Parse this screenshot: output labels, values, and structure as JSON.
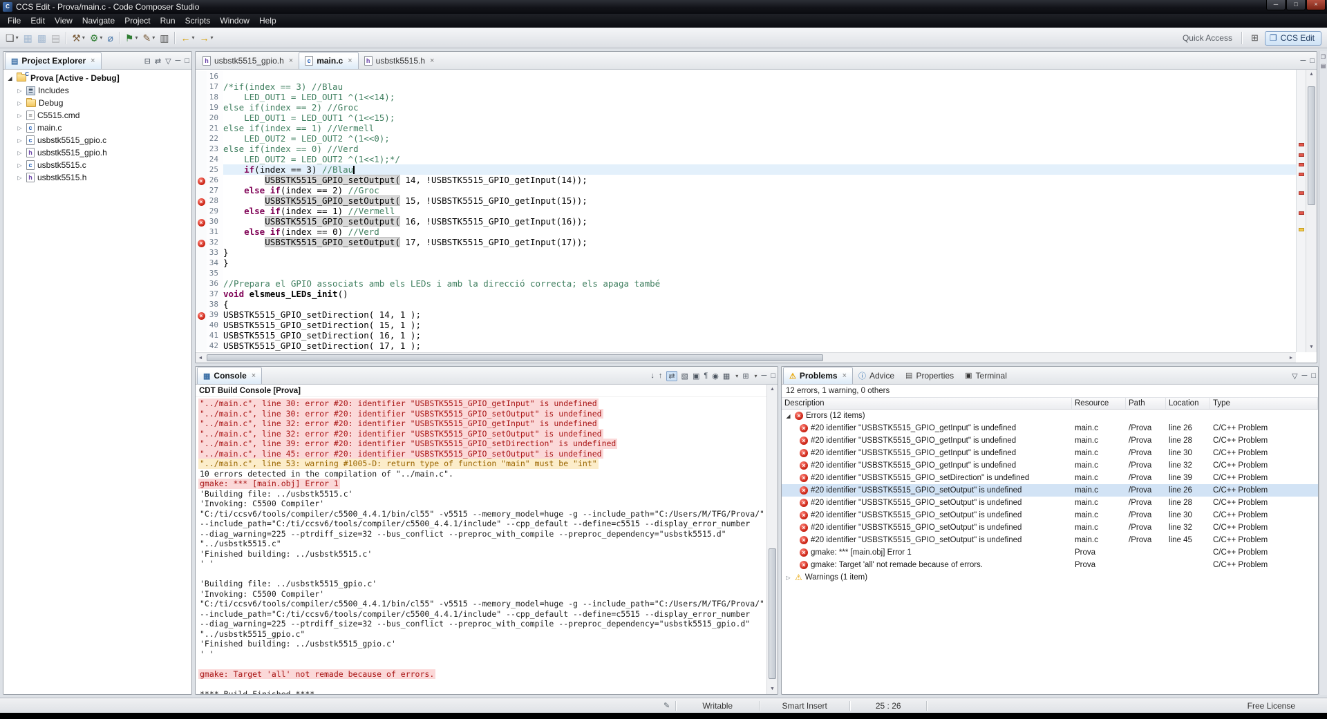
{
  "window": {
    "title": "CCS Edit - Prova/main.c - Code Composer Studio",
    "logo_text": "C",
    "controls": {
      "minimize": "─",
      "maximize": "□",
      "close": "×"
    }
  },
  "menu_bar": {
    "items": [
      "File",
      "Edit",
      "View",
      "Navigate",
      "Project",
      "Run",
      "Scripts",
      "Window",
      "Help"
    ]
  },
  "toolbar": {
    "quick_access_label": "Quick Access",
    "perspective_label": "CCS Edit",
    "items": [
      {
        "name": "new-file-icon",
        "glyph": "❏",
        "cls": "g-dark",
        "dropdown": true
      },
      {
        "name": "save-icon",
        "glyph": "▦",
        "cls": "g-blue",
        "disabled": true
      },
      {
        "name": "save-all-icon",
        "glyph": "▩",
        "cls": "g-blue",
        "disabled": true
      },
      {
        "name": "print-icon",
        "glyph": "▤",
        "cls": "g-dark",
        "disabled": true
      },
      {
        "sep": true
      },
      {
        "name": "build-icon",
        "glyph": "⚒",
        "cls": "g-brown",
        "dropdown": true
      },
      {
        "name": "debug-icon",
        "glyph": "⚙",
        "cls": "g-green",
        "dropdown": true
      },
      {
        "name": "search-icon",
        "glyph": "⌀",
        "cls": "g-blue"
      },
      {
        "sep": true
      },
      {
        "name": "run-flag-icon",
        "glyph": "⚑",
        "cls": "g-green",
        "dropdown": true
      },
      {
        "name": "highlight-icon",
        "glyph": "✎",
        "cls": "g-brown",
        "dropdown": true
      },
      {
        "name": "memory-browser-icon",
        "glyph": "▥",
        "cls": "g-dark"
      },
      {
        "sep": true
      },
      {
        "name": "back-icon",
        "glyph": "←",
        "cls": "g-gold",
        "dropdown": true
      },
      {
        "name": "forward-icon",
        "glyph": "→",
        "cls": "g-gold",
        "dropdown": true
      }
    ]
  },
  "project_explorer": {
    "title": "Project Explorer",
    "tools": [
      {
        "name": "collapse-all-icon",
        "glyph": "⊟"
      },
      {
        "name": "link-editor-icon",
        "glyph": "⇄"
      },
      {
        "name": "view-menu-icon",
        "glyph": "▽"
      },
      {
        "name": "minimize-icon",
        "glyph": "─"
      },
      {
        "name": "maximize-icon",
        "glyph": "□"
      }
    ],
    "tree": [
      {
        "label": "Prova [Active - Debug]",
        "icon": "project",
        "level": 0,
        "expanded": true,
        "bold": true
      },
      {
        "label": "Includes",
        "icon": "includes",
        "level": 1
      },
      {
        "label": "Debug",
        "icon": "folder",
        "level": 1
      },
      {
        "label": "C5515.cmd",
        "icon": "cmd-file",
        "level": 1
      },
      {
        "label": "main.c",
        "icon": "c-file",
        "level": 1
      },
      {
        "label": "usbstk5515_gpio.c",
        "icon": "c-file",
        "level": 1
      },
      {
        "label": "usbstk5515_gpio.h",
        "icon": "h-file",
        "level": 1
      },
      {
        "label": "usbstk5515.c",
        "icon": "c-file",
        "level": 1
      },
      {
        "label": "usbstk5515.h",
        "icon": "h-file",
        "level": 1
      }
    ]
  },
  "editor": {
    "tools": [
      {
        "name": "minimize-icon",
        "glyph": "─"
      },
      {
        "name": "maximize-icon",
        "glyph": "□"
      }
    ],
    "tabs": [
      {
        "label": "usbstk5515_gpio.h",
        "icon": "h-file",
        "active": false
      },
      {
        "label": "main.c",
        "icon": "c-file",
        "active": true
      },
      {
        "label": "usbstk5515.h",
        "icon": "h-file",
        "active": false
      }
    ],
    "lines": [
      {
        "num": 16,
        "tokens": []
      },
      {
        "num": 17,
        "tokens": [
          [
            "c",
            "/*if(index == 3) //Blau"
          ]
        ]
      },
      {
        "num": 18,
        "tokens": [
          [
            "c",
            "    LED_OUT1 = LED_OUT1 ^(1<<14);"
          ]
        ]
      },
      {
        "num": 19,
        "tokens": [
          [
            "c",
            "else if(index == 2) //Groc"
          ]
        ]
      },
      {
        "num": 20,
        "tokens": [
          [
            "c",
            "    LED_OUT1 = LED_OUT1 ^(1<<15);"
          ]
        ]
      },
      {
        "num": 21,
        "tokens": [
          [
            "c",
            "else if(index == 1) //Vermell"
          ]
        ]
      },
      {
        "num": 22,
        "tokens": [
          [
            "c",
            "    LED_OUT2 = LED_OUT2 ^(1<<0);"
          ]
        ]
      },
      {
        "num": 23,
        "tokens": [
          [
            "c",
            "else if(index == 0) //Verd"
          ]
        ]
      },
      {
        "num": 24,
        "tokens": [
          [
            "c",
            "    LED_OUT2 = LED_OUT2 ^(1<<1);*/"
          ]
        ]
      },
      {
        "num": 25,
        "current": true,
        "caret": true,
        "tokens": [
          [
            "t",
            "    "
          ],
          [
            "k",
            "if"
          ],
          [
            "t",
            "(index == 3) "
          ],
          [
            "c",
            "//Blau"
          ]
        ]
      },
      {
        "num": 26,
        "error": true,
        "tokens": [
          [
            "t",
            "        "
          ],
          [
            "hl",
            "USBSTK5515_GPIO_setOutput("
          ],
          [
            "t",
            " 14, !USBSTK5515_GPIO_getInput(14));"
          ]
        ]
      },
      {
        "num": 27,
        "tokens": [
          [
            "t",
            "    "
          ],
          [
            "k",
            "else"
          ],
          [
            "t",
            " "
          ],
          [
            "k",
            "if"
          ],
          [
            "t",
            "(index == 2) "
          ],
          [
            "c",
            "//Groc"
          ]
        ]
      },
      {
        "num": 28,
        "error": true,
        "tokens": [
          [
            "t",
            "        "
          ],
          [
            "hl",
            "USBSTK5515_GPIO_setOutput("
          ],
          [
            "t",
            " 15, !USBSTK5515_GPIO_getInput(15));"
          ]
        ]
      },
      {
        "num": 29,
        "tokens": [
          [
            "t",
            "    "
          ],
          [
            "k",
            "else"
          ],
          [
            "t",
            " "
          ],
          [
            "k",
            "if"
          ],
          [
            "t",
            "(index == 1) "
          ],
          [
            "c",
            "//Vermell"
          ]
        ]
      },
      {
        "num": 30,
        "error": true,
        "tokens": [
          [
            "t",
            "        "
          ],
          [
            "hl",
            "USBSTK5515_GPIO_setOutput("
          ],
          [
            "t",
            " 16, !USBSTK5515_GPIO_getInput(16));"
          ]
        ]
      },
      {
        "num": 31,
        "tokens": [
          [
            "t",
            "    "
          ],
          [
            "k",
            "else"
          ],
          [
            "t",
            " "
          ],
          [
            "k",
            "if"
          ],
          [
            "t",
            "(index == 0) "
          ],
          [
            "c",
            "//Verd"
          ]
        ]
      },
      {
        "num": 32,
        "error": true,
        "tokens": [
          [
            "t",
            "        "
          ],
          [
            "hl",
            "USBSTK5515_GPIO_setOutput("
          ],
          [
            "t",
            " 17, !USBSTK5515_GPIO_getInput(17));"
          ]
        ]
      },
      {
        "num": 33,
        "tokens": [
          [
            "t",
            "}"
          ]
        ]
      },
      {
        "num": 34,
        "tokens": [
          [
            "t",
            "}"
          ]
        ]
      },
      {
        "num": 35,
        "tokens": []
      },
      {
        "num": 36,
        "tokens": [
          [
            "c",
            "//Prepara el GPIO associats amb els LEDs i amb la direcció correcta; els apaga també"
          ]
        ]
      },
      {
        "num": 37,
        "tokens": [
          [
            "k",
            "void"
          ],
          [
            "t",
            " "
          ],
          [
            "b",
            "elsmeus_LEDs_init"
          ],
          [
            "t",
            "()"
          ]
        ]
      },
      {
        "num": 38,
        "tokens": [
          [
            "t",
            "{"
          ]
        ]
      },
      {
        "num": 39,
        "error": true,
        "tokens": [
          [
            "t",
            "USBSTK5515_GPIO_setDirection( 14, 1 );"
          ]
        ]
      },
      {
        "num": 40,
        "tokens": [
          [
            "t",
            "USBSTK5515_GPIO_setDirection( 15, 1 );"
          ]
        ]
      },
      {
        "num": 41,
        "tokens": [
          [
            "t",
            "USBSTK5515_GPIO_setDirection( 16, 1 );"
          ]
        ]
      },
      {
        "num": 42,
        "tokens": [
          [
            "t",
            "USBSTK5515_GPIO_setDirection( 17, 1 );"
          ]
        ]
      }
    ],
    "overview_marks": [
      26,
      29.5,
      33,
      36.5,
      43,
      50
    ],
    "overview_warn_mark": 56
  },
  "console": {
    "tab_label": "Console",
    "header": "CDT Build Console [Prova]",
    "tools": [
      {
        "name": "next-error-icon",
        "glyph": "↓",
        "cls": "g-gold"
      },
      {
        "name": "prev-error-icon",
        "glyph": "↑",
        "cls": "g-gold"
      },
      {
        "name": "sync-editor-icon",
        "glyph": "⇄",
        "cls": "g-blue",
        "pressed": true
      },
      {
        "name": "clear-console-icon",
        "glyph": "▧",
        "cls": "g-dark"
      },
      {
        "name": "scroll-lock-icon",
        "glyph": "▣",
        "cls": "g-dark"
      },
      {
        "name": "word-wrap-icon",
        "glyph": "¶",
        "cls": "g-dark"
      },
      {
        "name": "pin-console-icon",
        "glyph": "◉",
        "cls": "g-dark"
      },
      {
        "name": "display-selected-console-icon",
        "glyph": "▦",
        "cls": "g-blue",
        "dropdown": true
      },
      {
        "name": "open-console-icon",
        "glyph": "⊞",
        "cls": "g-blue",
        "dropdown": true
      },
      {
        "name": "minimize-icon",
        "glyph": "─",
        "cls": "g-dark"
      },
      {
        "name": "maximize-icon",
        "glyph": "□",
        "cls": "g-dark"
      }
    ],
    "lines": [
      {
        "s": "e",
        "text": "\"../main.c\", line 30: error #20: identifier \"USBSTK5515_GPIO_getInput\" is undefined"
      },
      {
        "s": "e",
        "text": "\"../main.c\", line 30: error #20: identifier \"USBSTK5515_GPIO_setOutput\" is undefined"
      },
      {
        "s": "e",
        "text": "\"../main.c\", line 32: error #20: identifier \"USBSTK5515_GPIO_getInput\" is undefined"
      },
      {
        "s": "e",
        "text": "\"../main.c\", line 32: error #20: identifier \"USBSTK5515_GPIO_setOutput\" is undefined"
      },
      {
        "s": "e",
        "text": "\"../main.c\", line 39: error #20: identifier \"USBSTK5515_GPIO_setDirection\" is undefined"
      },
      {
        "s": "e",
        "text": "\"../main.c\", line 45: error #20: identifier \"USBSTK5515_GPIO_setOutput\" is undefined"
      },
      {
        "s": "w",
        "text": "\"../main.c\", line 53: warning #1005-D: return type of function \"main\" must be \"int\""
      },
      {
        "s": "p",
        "text": "10 errors detected in the compilation of \"../main.c\"."
      },
      {
        "s": "e",
        "text": "gmake: *** [main.obj] Error 1"
      },
      {
        "s": "p",
        "text": "'Building file: ../usbstk5515.c'"
      },
      {
        "s": "p",
        "text": "'Invoking: C5500 Compiler'"
      },
      {
        "s": "p",
        "text": "\"C:/ti/ccsv6/tools/compiler/c5500_4.4.1/bin/cl55\" -v5515 --memory_model=huge -g --include_path=\"C:/Users/M/TFG/Prova/\""
      },
      {
        "s": "p",
        "text": "--include_path=\"C:/ti/ccsv6/tools/compiler/c5500_4.4.1/include\" --cpp_default --define=c5515 --display_error_number"
      },
      {
        "s": "p",
        "text": "--diag_warning=225 --ptrdiff_size=32 --bus_conflict --preproc_with_compile --preproc_dependency=\"usbstk5515.d\""
      },
      {
        "s": "p",
        "text": "\"../usbstk5515.c\""
      },
      {
        "s": "p",
        "text": "'Finished building: ../usbstk5515.c'"
      },
      {
        "s": "p",
        "text": "' '"
      },
      {
        "s": "b",
        "text": ""
      },
      {
        "s": "p",
        "text": "'Building file: ../usbstk5515_gpio.c'"
      },
      {
        "s": "p",
        "text": "'Invoking: C5500 Compiler'"
      },
      {
        "s": "p",
        "text": "\"C:/ti/ccsv6/tools/compiler/c5500_4.4.1/bin/cl55\" -v5515 --memory_model=huge -g --include_path=\"C:/Users/M/TFG/Prova/\""
      },
      {
        "s": "p",
        "text": "--include_path=\"C:/ti/ccsv6/tools/compiler/c5500_4.4.1/include\" --cpp_default --define=c5515 --display_error_number"
      },
      {
        "s": "p",
        "text": "--diag_warning=225 --ptrdiff_size=32 --bus_conflict --preproc_with_compile --preproc_dependency=\"usbstk5515_gpio.d\""
      },
      {
        "s": "p",
        "text": "\"../usbstk5515_gpio.c\""
      },
      {
        "s": "p",
        "text": "'Finished building: ../usbstk5515_gpio.c'"
      },
      {
        "s": "p",
        "text": "' '"
      },
      {
        "s": "b",
        "text": ""
      },
      {
        "s": "e",
        "text": "gmake: Target 'all' not remade because of errors."
      },
      {
        "s": "b",
        "text": ""
      },
      {
        "s": "p",
        "text": "**** Build Finished ****"
      }
    ]
  },
  "problems": {
    "tabs": [
      {
        "label": "Problems",
        "icon": "problems",
        "active": true
      },
      {
        "label": "Advice",
        "icon": "advice",
        "active": false
      },
      {
        "label": "Properties",
        "icon": "properties",
        "active": false
      },
      {
        "label": "Terminal",
        "icon": "terminal",
        "active": false
      }
    ],
    "tools": [
      {
        "name": "view-menu-icon",
        "glyph": "▽"
      },
      {
        "name": "minimize-icon",
        "glyph": "─"
      },
      {
        "name": "maximize-icon",
        "glyph": "□"
      }
    ],
    "summary": "12 errors, 1 warning, 0 others",
    "columns": [
      "Description",
      "Resource",
      "Path",
      "Location",
      "Type"
    ],
    "groups": [
      {
        "label": "Errors (12 items)",
        "severity": "error",
        "expanded": true,
        "items": [
          {
            "desc": "#20 identifier \"USBSTK5515_GPIO_getInput\" is undefined",
            "res": "main.c",
            "path": "/Prova",
            "loc": "line 26",
            "type": "C/C++ Problem"
          },
          {
            "desc": "#20 identifier \"USBSTK5515_GPIO_getInput\" is undefined",
            "res": "main.c",
            "path": "/Prova",
            "loc": "line 28",
            "type": "C/C++ Problem"
          },
          {
            "desc": "#20 identifier \"USBSTK5515_GPIO_getInput\" is undefined",
            "res": "main.c",
            "path": "/Prova",
            "loc": "line 30",
            "type": "C/C++ Problem"
          },
          {
            "desc": "#20 identifier \"USBSTK5515_GPIO_getInput\" is undefined",
            "res": "main.c",
            "path": "/Prova",
            "loc": "line 32",
            "type": "C/C++ Problem"
          },
          {
            "desc": "#20 identifier \"USBSTK5515_GPIO_setDirection\" is undefined",
            "res": "main.c",
            "path": "/Prova",
            "loc": "line 39",
            "type": "C/C++ Problem"
          },
          {
            "desc": "#20 identifier \"USBSTK5515_GPIO_setOutput\" is undefined",
            "res": "main.c",
            "path": "/Prova",
            "loc": "line 26",
            "type": "C/C++ Problem",
            "selected": true
          },
          {
            "desc": "#20 identifier \"USBSTK5515_GPIO_setOutput\" is undefined",
            "res": "main.c",
            "path": "/Prova",
            "loc": "line 28",
            "type": "C/C++ Problem"
          },
          {
            "desc": "#20 identifier \"USBSTK5515_GPIO_setOutput\" is undefined",
            "res": "main.c",
            "path": "/Prova",
            "loc": "line 30",
            "type": "C/C++ Problem"
          },
          {
            "desc": "#20 identifier \"USBSTK5515_GPIO_setOutput\" is undefined",
            "res": "main.c",
            "path": "/Prova",
            "loc": "line 32",
            "type": "C/C++ Problem"
          },
          {
            "desc": "#20 identifier \"USBSTK5515_GPIO_setOutput\" is undefined",
            "res": "main.c",
            "path": "/Prova",
            "loc": "line 45",
            "type": "C/C++ Problem"
          },
          {
            "desc": "gmake: *** [main.obj] Error 1",
            "res": "Prova",
            "path": "",
            "loc": "",
            "type": "C/C++ Problem"
          },
          {
            "desc": "gmake: Target 'all' not remade because of errors.",
            "res": "Prova",
            "path": "",
            "loc": "",
            "type": "C/C++ Problem"
          }
        ]
      },
      {
        "label": "Warnings (1 item)",
        "severity": "warning",
        "expanded": false,
        "items": []
      }
    ]
  },
  "status_bar": {
    "writable": "Writable",
    "input_mode": "Smart Insert",
    "position": "25 : 26",
    "license": "Free License"
  }
}
